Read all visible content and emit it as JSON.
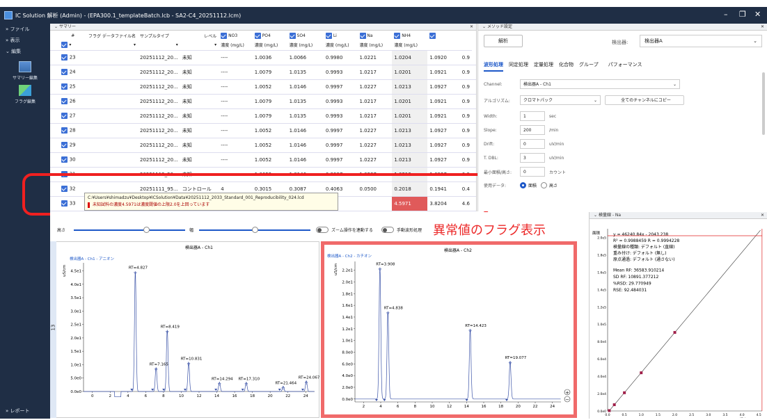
{
  "window": {
    "title": "IC Solution 解析 (Admin) - (EPA300.1_templateBatch.lcb - SA2-C4_20251112.lcm)"
  },
  "left_nav": {
    "items": [
      "ファイル",
      "表示",
      "編集"
    ],
    "tools": [
      "サマリー編集",
      "フラグ編集"
    ],
    "report": "レポート"
  },
  "summary": {
    "title": "サマリー",
    "headers": [
      "#",
      "フラグ",
      "データファイル名",
      "サンプルタイプ",
      "レベル",
      "NO3",
      "PO4",
      "SO4",
      "Li",
      "Na",
      "NH4"
    ],
    "unit_header": "濃度 (mg/L)",
    "rows": [
      {
        "n": "23",
        "file": "20251112_20...",
        "type": "未知",
        "level": "----",
        "v": [
          "1.0036",
          "1.0066",
          "0.9980",
          "1.0221",
          "1.0204",
          "1.0920",
          "0.9"
        ]
      },
      {
        "n": "24",
        "file": "20251112_20...",
        "type": "未知",
        "level": "----",
        "v": [
          "1.0079",
          "1.0135",
          "0.9993",
          "1.0217",
          "1.0201",
          "1.0921",
          "0.9"
        ]
      },
      {
        "n": "25",
        "file": "20251112_20...",
        "type": "未知",
        "level": "----",
        "v": [
          "1.0052",
          "1.0146",
          "0.9997",
          "1.0227",
          "1.0213",
          "1.0927",
          "0.9"
        ]
      },
      {
        "n": "26",
        "file": "20251112_20...",
        "type": "未知",
        "level": "----",
        "v": [
          "1.0079",
          "1.0135",
          "0.9993",
          "1.0217",
          "1.0201",
          "1.0921",
          "0.9"
        ]
      },
      {
        "n": "27",
        "file": "20251112_20...",
        "type": "未知",
        "level": "----",
        "v": [
          "1.0079",
          "1.0135",
          "0.9993",
          "1.0217",
          "1.0201",
          "1.0921",
          "0.9"
        ]
      },
      {
        "n": "28",
        "file": "20251112_20...",
        "type": "未知",
        "level": "----",
        "v": [
          "1.0052",
          "1.0146",
          "0.9997",
          "1.0227",
          "1.0213",
          "1.0927",
          "0.9"
        ]
      },
      {
        "n": "29",
        "file": "20251112_20...",
        "type": "未知",
        "level": "----",
        "v": [
          "1.0052",
          "1.0146",
          "0.9997",
          "1.0227",
          "1.0213",
          "1.0927",
          "0.9"
        ]
      },
      {
        "n": "30",
        "file": "20251112_20...",
        "type": "未知",
        "level": "----",
        "v": [
          "1.0052",
          "1.0146",
          "0.9997",
          "1.0227",
          "1.0213",
          "1.0927",
          "0.9"
        ]
      },
      {
        "n": "31",
        "file": "20251112_20...",
        "type": "未知",
        "level": "----",
        "v": [
          "1.0052",
          "1.0146",
          "0.9997",
          "1.0227",
          "1.0213",
          "1.0927",
          "0.9"
        ]
      },
      {
        "n": "32",
        "file": "20251111_95...",
        "type": "コントロール",
        "level": "4",
        "v": [
          "0.3015",
          "0.3087",
          "0.4063",
          "0.0500",
          "0.2018",
          "0.1941",
          "0.4"
        ]
      },
      {
        "n": "33",
        "file": "",
        "type": "",
        "level": "----",
        "v": [
          "",
          "",
          "",
          "",
          "4.5971",
          "3.8204",
          "4.6"
        ]
      }
    ],
    "tooltip_path": "C:¥Users¥shimadzu¥Desktop¥ICSolution¥Data¥20251112_2033_Standard_001_Reproducibility_024.lcd",
    "tooltip_warning": "未知試料の濃度4.5971は濃度閾値の上限2.0を上回っています"
  },
  "method": {
    "title": "メソッド設定",
    "analyze_label": "解析",
    "detector_label": "検出器:",
    "detector_value": "検出器A",
    "tabs": [
      "波形処理",
      "同定処理",
      "定量処理",
      "化合物",
      "グループ",
      "パフォーマンス"
    ],
    "channel_label": "Channel:",
    "channel_value": "検出器A - Ch1",
    "algo_label": "アルゴリズム:",
    "algo_value": "クロマトパック",
    "copy_all_label": "全てのチャンネルにコピー",
    "params": [
      {
        "label": "Width:",
        "value": "1",
        "unit": "sec"
      },
      {
        "label": "Slope:",
        "value": "200",
        "unit": "/min"
      },
      {
        "label": "Drift:",
        "value": "0",
        "unit": "uV/min"
      },
      {
        "label": "T. DBL:",
        "value": "3",
        "unit": "uV/min"
      },
      {
        "label": "最小面積/高さ:",
        "value": "0",
        "unit": "カウント"
      }
    ],
    "use_data_label": "使用データ:",
    "area_label": "面積",
    "height_label": "高さ"
  },
  "controls": {
    "height_label": "高さ",
    "width_label": "幅",
    "zoom_link_label": "ズーム操作を連動する",
    "manual_label": "手動波形処理"
  },
  "annotation": "異常値のフラグ表示",
  "chrom1": {
    "title": "検出器A - Ch1",
    "subtitle": "検出器A - Ch1 - アニオン",
    "ylabel": "uS/cm",
    "side_label": "13",
    "yticks": [
      "4.5e1",
      "4.0e1",
      "3.5e1",
      "3.0e1",
      "2.5e1",
      "2.0e1",
      "1.5e1",
      "1.0e1",
      "5.0e0",
      "0.0e0"
    ],
    "xticks": [
      "0",
      "2",
      "4",
      "6",
      "8",
      "10",
      "12",
      "14",
      "16",
      "18",
      "20",
      "22",
      "24"
    ],
    "peaks": [
      {
        "rt": 4.827,
        "h": 45,
        "label": "RT=4.827"
      },
      {
        "rt": 7.165,
        "h": 9,
        "label": "RT=7.165"
      },
      {
        "rt": 8.419,
        "h": 23,
        "label": "RT=8.419"
      },
      {
        "rt": 10.831,
        "h": 11,
        "label": "RT=10.831"
      },
      {
        "rt": 14.294,
        "h": 3.5,
        "label": "RT=14.294"
      },
      {
        "rt": 17.31,
        "h": 3.5,
        "label": "RT=17.310"
      },
      {
        "rt": 21.464,
        "h": 2,
        "label": "RT=21.464"
      },
      {
        "rt": 24.067,
        "h": 4,
        "label": "RT=24.067"
      }
    ]
  },
  "chrom2": {
    "title": "検出器A - Ch2",
    "subtitle": "検出器A - Ch2 - カチオン",
    "ylabel": "uS/cm",
    "yticks": [
      "2.2e1",
      "2.0e1",
      "1.8e1",
      "1.6e1",
      "1.4e1",
      "1.2e1",
      "1.0e1",
      "8.0e0",
      "6.0e0",
      "4.0e0",
      "2.0e0",
      "0.0e0"
    ],
    "xticks": [
      "2",
      "4",
      "6",
      "8",
      "10",
      "12",
      "14",
      "16",
      "18",
      "20",
      "22",
      "24"
    ],
    "peaks": [
      {
        "rt": 3.908,
        "h": 22.5,
        "label": "RT=3.908"
      },
      {
        "rt": 4.838,
        "h": 15,
        "label": "RT=4.838"
      },
      {
        "rt": 14.423,
        "h": 12,
        "label": "RT=14.423"
      },
      {
        "rt": 19.077,
        "h": 6.5,
        "label": "RT=19.077"
      }
    ]
  },
  "calib": {
    "title": "検量線 - Na",
    "ylabel": "面積",
    "xlabel": "濃度 (mg/L)",
    "lines": [
      "y = 46240.84x - 2043.238",
      "R² = 0.9988459   R = 0.9994228",
      "検量線の種類: デフォルト (直線)",
      "重み付け: デフォルト (無し)",
      "原点通過: デフォルト (通さない)",
      "Mean RF: 36583.910214",
      "SD RF: 10891.377212",
      "%RSD: 29.770949",
      "RSE: 92.484031"
    ],
    "yticks": [
      "2.0e5",
      "1.8e5",
      "1.6e5",
      "1.4e5",
      "1.2e5",
      "1.0e5",
      "8.0e4",
      "6.0e4",
      "4.0e4",
      "2.0e4",
      "0.0e0"
    ],
    "xticks": [
      "0.0",
      "0.5",
      "1.0",
      "1.5",
      "2.0",
      "2.5",
      "3.0",
      "3.5",
      "4.0",
      "4.5"
    ],
    "points": [
      [
        0.05,
        400
      ],
      [
        0.2,
        7200
      ],
      [
        0.5,
        21000
      ],
      [
        1.0,
        44000
      ],
      [
        2.0,
        90500
      ]
    ],
    "flag_x": 4.5971
  }
}
